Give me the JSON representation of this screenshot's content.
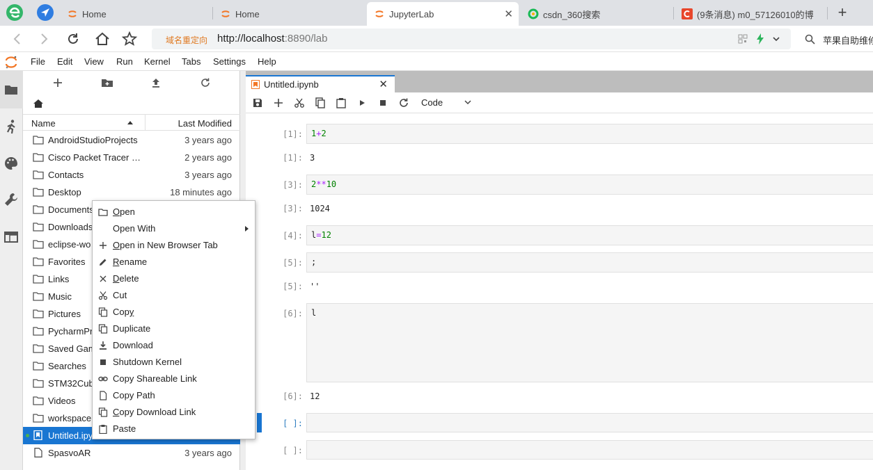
{
  "browser": {
    "tabs": [
      {
        "title": "Home",
        "icon": "jupyter-favicon"
      },
      {
        "title": "Home",
        "icon": "jupyter-favicon"
      },
      {
        "title": "JupyterLab",
        "icon": "jupyter-favicon",
        "active": true
      },
      {
        "title": "csdn_360搜索",
        "icon": "360-search-favicon"
      },
      {
        "title": "(9条消息) m0_57126010的博",
        "icon": "csdn-favicon"
      }
    ],
    "redirect_label": "域名重定向",
    "url_host": "http://localhost",
    "url_rest": ":8890/lab",
    "search_text": "苹果自助维修"
  },
  "menubar": {
    "items": [
      "File",
      "Edit",
      "View",
      "Run",
      "Kernel",
      "Tabs",
      "Settings",
      "Help"
    ]
  },
  "filebrowser": {
    "header_name": "Name",
    "header_modified": "Last Modified",
    "files": [
      {
        "name": "AndroidStudioProjects",
        "modified": "3 years ago",
        "type": "folder"
      },
      {
        "name": "Cisco Packet Tracer 6....",
        "modified": "2 years ago",
        "type": "folder"
      },
      {
        "name": "Contacts",
        "modified": "3 years ago",
        "type": "folder"
      },
      {
        "name": "Desktop",
        "modified": "18 minutes ago",
        "type": "folder"
      },
      {
        "name": "Documents",
        "modified": "",
        "type": "folder"
      },
      {
        "name": "Downloads",
        "modified": "",
        "type": "folder"
      },
      {
        "name": "eclipse-wo",
        "modified": "",
        "type": "folder"
      },
      {
        "name": "Favorites",
        "modified": "",
        "type": "folder"
      },
      {
        "name": "Links",
        "modified": "",
        "type": "folder"
      },
      {
        "name": "Music",
        "modified": "",
        "type": "folder"
      },
      {
        "name": "Pictures",
        "modified": "",
        "type": "folder"
      },
      {
        "name": "PycharmPro",
        "modified": "",
        "type": "folder"
      },
      {
        "name": "Saved Gam",
        "modified": "",
        "type": "folder"
      },
      {
        "name": "Searches",
        "modified": "",
        "type": "folder"
      },
      {
        "name": "STM32Cub",
        "modified": "",
        "type": "folder"
      },
      {
        "name": "Videos",
        "modified": "",
        "type": "folder"
      },
      {
        "name": "workspace",
        "modified": "",
        "type": "folder"
      },
      {
        "name": "Untitled.ipy",
        "modified": "",
        "type": "notebook",
        "selected": true
      },
      {
        "name": "SpasvoAR",
        "modified": "3 years ago",
        "type": "file"
      }
    ]
  },
  "context_menu": {
    "items": [
      {
        "label": "Open",
        "underline": "O",
        "icon": "folder-icon"
      },
      {
        "label": "Open With",
        "underline": "",
        "icon": "",
        "submenu": true
      },
      {
        "label": "Open in New Browser Tab",
        "underline": "O",
        "icon": "plus-icon"
      },
      {
        "label": "Rename",
        "underline": "R",
        "icon": "pencil-icon"
      },
      {
        "label": "Delete",
        "underline": "D",
        "icon": "close-icon"
      },
      {
        "label": "Cut",
        "underline": "",
        "icon": "scissors-icon"
      },
      {
        "label": "Copy",
        "underline": "y",
        "icon": "copy-icon"
      },
      {
        "label": "Duplicate",
        "underline": "",
        "icon": "copy-icon"
      },
      {
        "label": "Download",
        "underline": "",
        "icon": "download-icon"
      },
      {
        "label": "Shutdown Kernel",
        "underline": "",
        "icon": "stop-icon"
      },
      {
        "label": "Copy Shareable Link",
        "underline": "",
        "icon": "link-icon"
      },
      {
        "label": "Copy Path",
        "underline": "",
        "icon": "file-icon"
      },
      {
        "label": "Copy Download Link",
        "underline": "C",
        "icon": "copy-icon"
      },
      {
        "label": "Paste",
        "underline": "",
        "icon": "paste-icon"
      }
    ]
  },
  "notebook": {
    "tab_title": "Untitled.ipynb",
    "cell_type": "Code",
    "cells": [
      {
        "in_prompt": "[1]:",
        "code": "1+2",
        "out_prompt": "[1]:",
        "output": "3"
      },
      {
        "in_prompt": "[3]:",
        "code": "2**10",
        "out_prompt": "[3]:",
        "output": "1024"
      },
      {
        "in_prompt": "[4]:",
        "code": "l=12",
        "out_prompt": "",
        "output": ""
      },
      {
        "in_prompt": "[5]:",
        "code": ";",
        "out_prompt": "[5]:",
        "output": "''"
      },
      {
        "in_prompt": "[6]:",
        "code": "l",
        "out_prompt": "[6]:",
        "output": "12"
      },
      {
        "in_prompt": "[ ]:",
        "code": "",
        "out_prompt": "",
        "output": ""
      },
      {
        "in_prompt": "[ ]:",
        "code": "",
        "out_prompt": "",
        "output": ""
      }
    ]
  },
  "colors": {
    "accent": "#1976d2",
    "jupyter_orange": "#f37726",
    "active_prompt": "#307fc1"
  }
}
